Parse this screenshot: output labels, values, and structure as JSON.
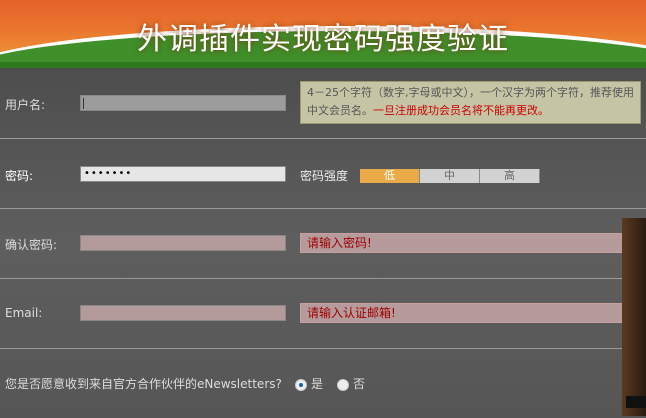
{
  "header": {
    "title": "外调插件实现密码强度验证"
  },
  "username": {
    "label": "用户名:",
    "hint_text": "4－25个字符（数字,字母或中文），一个汉字为两个字符，推荐使用中文会员名。",
    "hint_warning": "一旦注册成功会员名将不能再更改。"
  },
  "password": {
    "label": "密码:",
    "value": "•••••••",
    "strength_label": "密码强度",
    "levels": [
      "低",
      "中",
      "高"
    ],
    "active_level": "低"
  },
  "confirm": {
    "label": "确认密码:",
    "error": "请输入密码!"
  },
  "email": {
    "label": "Email:",
    "error": "请输入认证邮箱!"
  },
  "newsletter": {
    "question": "您是否愿意收到来自官方合作伙伴的eNewsletters?",
    "yes": "是",
    "no": "否"
  },
  "colors": {
    "strength_low": "#eaaa48",
    "error_text": "#a00000",
    "header_green": "#3f8f2a"
  }
}
